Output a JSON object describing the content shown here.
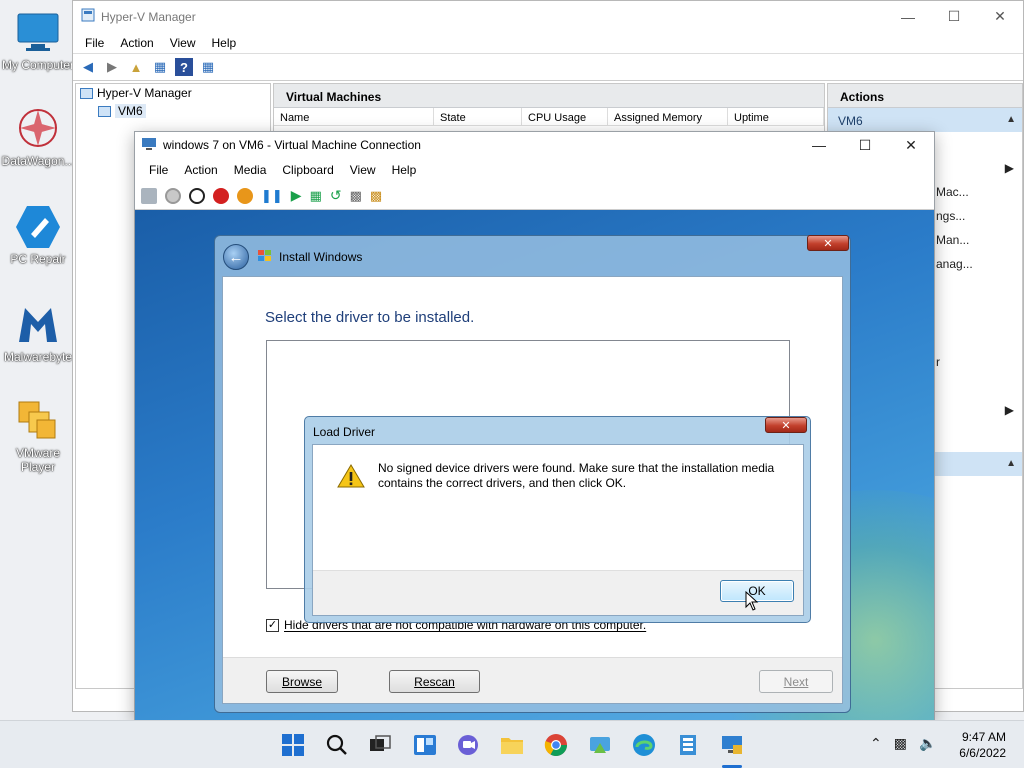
{
  "desktop": {
    "icons": [
      {
        "label": "My Computer",
        "icon": "monitor-icon"
      },
      {
        "label": "DataWagon...",
        "icon": "datawagon-icon"
      },
      {
        "label": "PC Repair",
        "icon": "pc-repair-icon"
      },
      {
        "label": "Malwarebyte",
        "icon": "malwarebytes-icon"
      },
      {
        "label": "VMware Player",
        "icon": "vmware-icon"
      }
    ]
  },
  "hyperv": {
    "title": "Hyper-V Manager",
    "menu": [
      "File",
      "Action",
      "View",
      "Help"
    ],
    "tree": {
      "root": "Hyper-V Manager",
      "child": "VM6"
    },
    "vm_panel": {
      "title": "Virtual Machines",
      "columns": [
        "Name",
        "State",
        "CPU Usage",
        "Assigned Memory",
        "Uptime"
      ]
    },
    "actions": {
      "title": "Actions",
      "selected": "VM6",
      "items": [
        "Mac...",
        "ngs...",
        "Man...",
        "anag...",
        "r"
      ]
    }
  },
  "vmconn": {
    "title": "windows 7 on VM6 - Virtual Machine Connection",
    "menu": [
      "File",
      "Action",
      "Media",
      "Clipboard",
      "View",
      "Help"
    ]
  },
  "install": {
    "title": "Install Windows",
    "heading": "Select the driver to be installed.",
    "checkbox_label": "Hide drivers that are not compatible with hardware on this computer.",
    "checkbox_checked": true,
    "browse": "Browse",
    "rescan": "Rescan",
    "next": "Next"
  },
  "load_driver": {
    "title": "Load Driver",
    "message": "No signed device drivers were found. Make sure that the installation media contains the correct drivers, and then click OK.",
    "ok": "OK"
  },
  "taskbar": {
    "time": "9:47 AM",
    "date": "6/6/2022"
  }
}
